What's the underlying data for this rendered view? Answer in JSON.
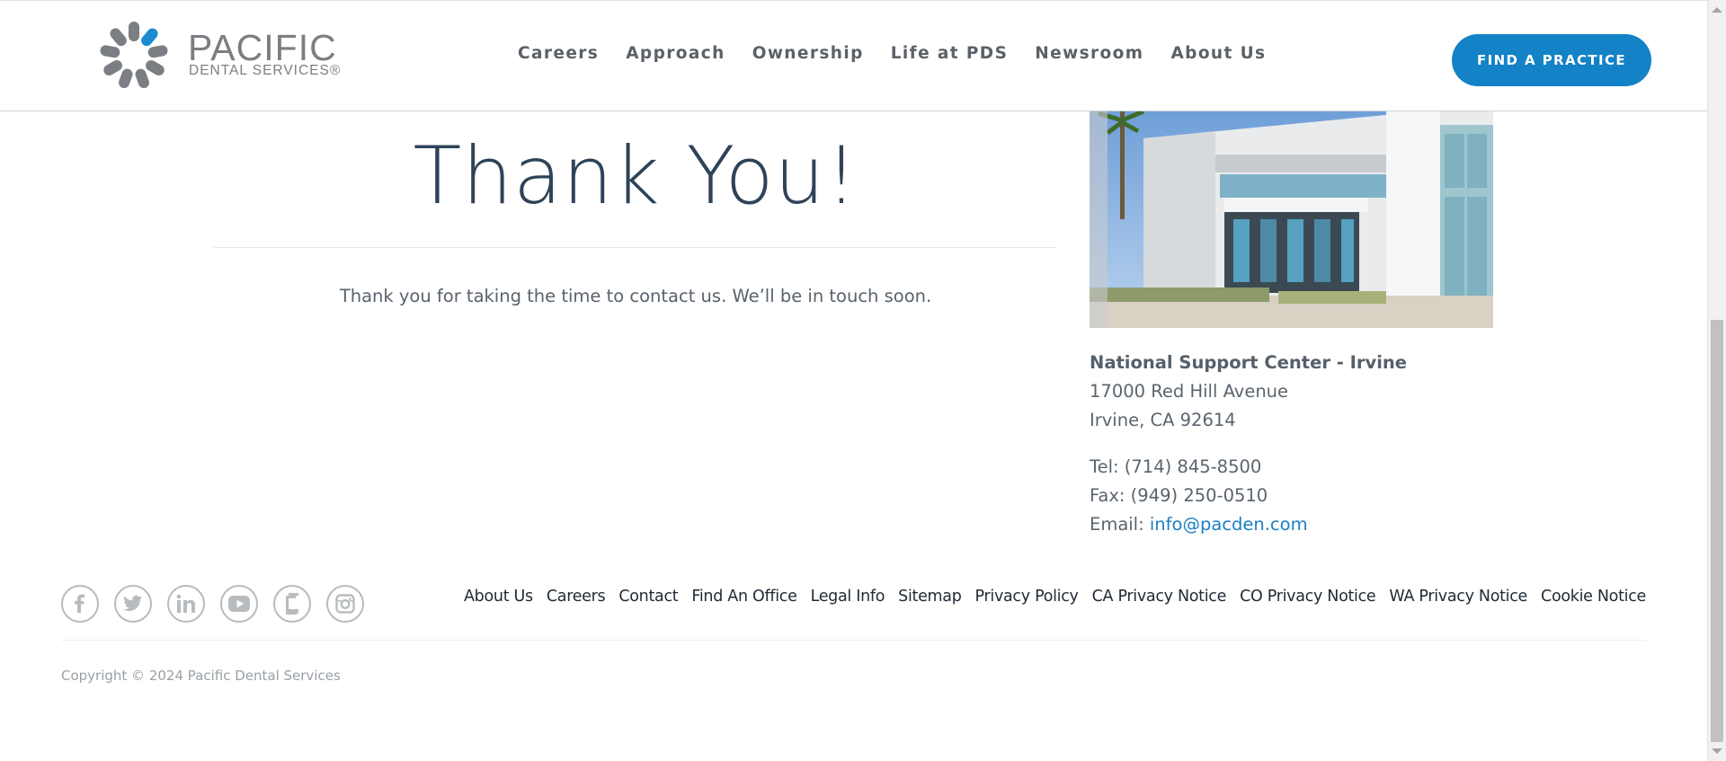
{
  "header": {
    "logo_word": "PACIFIC",
    "logo_sub": "DENTAL SERVICES®",
    "nav": [
      "Careers",
      "Approach",
      "Ownership",
      "Life at PDS",
      "Newsroom",
      "About Us"
    ],
    "cta_label": "FIND A PRACTICE"
  },
  "main": {
    "title": "Thank You!",
    "message": "Thank you for taking the time to contact us. We’ll be in touch soon."
  },
  "office": {
    "name": "National Support Center - Irvine",
    "street": "17000 Red Hill Avenue",
    "city": "Irvine, CA 92614",
    "tel": "Tel: (714) 845-8500",
    "fax": "Fax: (949) 250-0510",
    "email_label": "Email: ",
    "email": "info@pacden.com"
  },
  "footer": {
    "socials": [
      "facebook-icon",
      "twitter-icon",
      "linkedin-icon",
      "youtube-icon",
      "glassdoor-icon",
      "instagram-icon"
    ],
    "links": [
      "About Us",
      "Careers",
      "Contact",
      "Find An Office",
      "Legal Info",
      "Sitemap",
      "Privacy Policy",
      "CA Privacy Notice",
      "CO Privacy Notice",
      "WA Privacy Notice",
      "Cookie Notice"
    ],
    "copyright": "Copyright © 2024 Pacific Dental Services"
  },
  "colors": {
    "brand_blue": "#1482c7",
    "title_navy": "#2e4358",
    "logo_gray": "#7b7e82"
  }
}
